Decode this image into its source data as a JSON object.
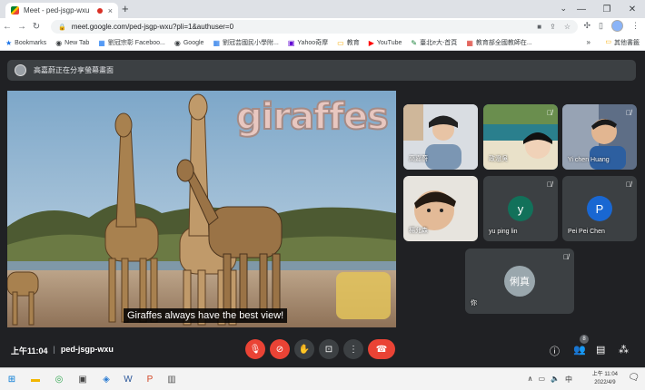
{
  "browser": {
    "tab_title": "Meet - ped-jsgp-wxu",
    "tab_close": "×",
    "new_tab": "+",
    "window_controls": [
      "⌄",
      "—",
      "❐",
      "✕"
    ],
    "url": "meet.google.com/ped-jsgp-wxu?pli=1&authuser=0",
    "profile_label": "裕興"
  },
  "bookmarks": {
    "items": [
      {
        "icon": "★",
        "label": "Bookmarks"
      },
      {
        "icon": "◉",
        "label": "New Tab"
      },
      {
        "icon": "▦",
        "label": "劉冠宗彰 Faceboo..."
      },
      {
        "icon": "◉",
        "label": "Google"
      },
      {
        "icon": "▦",
        "label": "劉冠芸國民小學附..."
      },
      {
        "icon": "▣",
        "label": "Yahoo奇摩"
      },
      {
        "icon": "▭",
        "label": "教育"
      },
      {
        "icon": "▶",
        "label": "YouTube"
      },
      {
        "icon": "✎",
        "label": "臺北e大-首頁"
      },
      {
        "icon": "▦",
        "label": "教育部全國教師在..."
      }
    ],
    "more": "»",
    "other": "其他書籤"
  },
  "meet": {
    "share_notice": "高嘉蔚正在分享螢幕畫面",
    "presentation": {
      "title_overlay": "giraffes",
      "caption": "Giraffes always have the best view!"
    },
    "tiles": [
      {
        "name": "高嘉蔚",
        "type": "video",
        "muted": false
      },
      {
        "name": "政澄吳",
        "type": "video",
        "muted": true
      },
      {
        "name": "Yi chen Huang",
        "type": "video",
        "muted": true
      },
      {
        "name": "楊允森",
        "type": "video",
        "muted": false
      },
      {
        "name": "yu ping lin",
        "type": "avatar",
        "initial": "y",
        "color": "#12715a",
        "muted": true
      },
      {
        "name": "Pei Pei Chen",
        "type": "avatar",
        "initial": "P",
        "color": "#1967d2",
        "muted": true
      },
      {
        "name": "你",
        "type": "avatar",
        "initial": "俐真",
        "color": "#9aa7ad",
        "muted": true
      }
    ],
    "time": "上午11:04",
    "separator": "|",
    "meeting_code": "ped-jsgp-wxu",
    "participants_count": "8"
  },
  "taskbar": {
    "clock_time": "上午 11:04",
    "clock_date": "2022/4/9"
  },
  "colors": {
    "end_call": "#ea4335",
    "muted": "#ea4335",
    "meet_bg": "#202124"
  }
}
